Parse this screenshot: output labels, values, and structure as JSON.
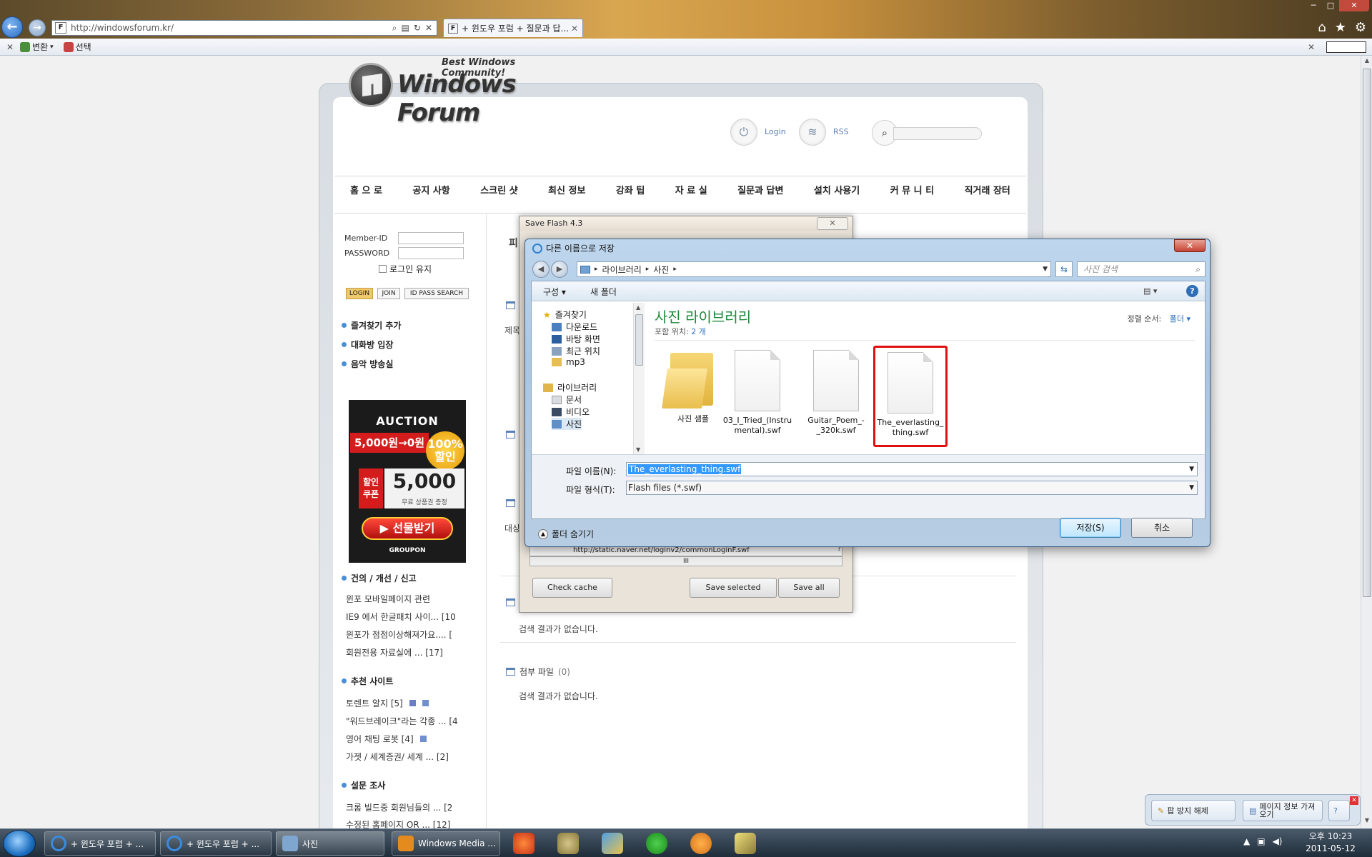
{
  "browser": {
    "url": "http://windowsforum.kr/",
    "tab_title": "+ 윈도우 포럼 + 질문과 답...",
    "cmd_convert": "변환",
    "cmd_select": "선택"
  },
  "site": {
    "logo_tagline": "Best Windows Community!",
    "logo_text": "Windows Forum",
    "login_link": "Login",
    "rss_link": "RSS",
    "nav": [
      "홈 으 로",
      "공지 사항",
      "스크린 샷",
      "최신 정보",
      "강좌 팁",
      "자 료 실",
      "질문과 답변",
      "설치 사용기",
      "커 뮤 니 티",
      "직거래 장터"
    ],
    "login": {
      "member_id_label": "Member-ID",
      "password_label": "PASSWORD",
      "keep_label": "로그인 유지",
      "login_btn": "LOGIN",
      "join_btn": "JOIN",
      "idpass_btn": "ID PASS SEARCH"
    },
    "menu": [
      "즐겨찾기 추가",
      "대화방 입장",
      "음악 방송실"
    ],
    "ad": {
      "brand": "AUCTION",
      "price": "5,000원→0원",
      "badge": "100% 할인",
      "coupon": "할인 쿠폰",
      "big": "5,000",
      "sub": "무료 상품권 증정",
      "gift": "▶ 선물받기",
      "groupon": "GROUPON"
    },
    "sections": [
      {
        "title": "건의 / 개선 / 신고",
        "items": [
          "윈포 모바일페이지 관련",
          "IE9 에서 한글패치 사이... [10",
          "윈포가 점점이상해져가요.... [",
          "회원전용 자료실에 ... [17]"
        ]
      },
      {
        "title": "추천 사이트",
        "items": [
          "토렌트 알지 [5]",
          "\"워드브레이크\"라는 각종 ... [4",
          "영어 채팅 로봇 [4]",
          "가젯 / 세계증권/ 세계 ... [2]"
        ]
      },
      {
        "title": "설문 조사",
        "items": [
          "크롬 빌드중 회원님들의 ... [2",
          "수정된 홈페이지 OR ... [12]"
        ]
      }
    ],
    "center": {
      "snip_pa": "피",
      "snip_je": "제목",
      "snip_dae": "대상",
      "no_result_1": "검색 결과가 없습니다.",
      "attach_title": "첨부 파일",
      "attach_count": "(0)",
      "no_result_2": "검색 결과가 없습니다."
    }
  },
  "save_flash": {
    "title": "Save Flash 4.3",
    "row_url": "http://static.naver.net/loginv2/commonLoginF.swf",
    "row_q": "?",
    "scroll_mid": "III",
    "check_cache": "Check cache",
    "save_selected": "Save selected",
    "save_all": "Save all"
  },
  "dialog": {
    "title": "다른 이름으로 저장",
    "close": "✕",
    "crumb_1": "라이브러리",
    "crumb_2": "사진",
    "search_placeholder": "사진 검색",
    "organize": "구성 ▾",
    "new_folder": "새 폴더",
    "nav": {
      "favorites": "즐겨찾기",
      "downloads": "다운로드",
      "desktop": "바탕 화면",
      "recent": "최근 위치",
      "mp3": "mp3",
      "libraries": "라이브러리",
      "docs": "문서",
      "video": "비디오",
      "pictures": "사진"
    },
    "library_title": "사진 라이브러리",
    "library_sub_label": "포함 위치:",
    "library_sub_value": "2 개",
    "sort_label": "정렬 순서:",
    "sort_value": "폴더 ▾",
    "files": [
      {
        "name": "사진 샘플",
        "kind": "folder"
      },
      {
        "name": "03_I_Tried_(Instrumental).swf",
        "kind": "file"
      },
      {
        "name": "Guitar_Poem_-_320k.swf",
        "kind": "file"
      },
      {
        "name": "The_everlasting_thing.swf",
        "kind": "file",
        "selected": true
      }
    ],
    "filename_label": "파일 이름(N):",
    "filename_value": "The_everlasting_thing.swf",
    "filetype_label": "파일 형식(T):",
    "filetype_value": "Flash files (*.swf)",
    "hide_folders": "폴더 숨기기",
    "save_btn": "저장(S)",
    "cancel_btn": "취소"
  },
  "infobar": {
    "popup": "팝 방지 해제",
    "page_info": "페이지 정보 가져오기"
  },
  "taskbar": {
    "items": [
      "+ 윈도우 포럼 + ...",
      "+ 윈도우 포럼 + ...",
      "사진",
      "Windows Media ..."
    ],
    "time": "오후 10:23",
    "date": "2011-05-12"
  }
}
